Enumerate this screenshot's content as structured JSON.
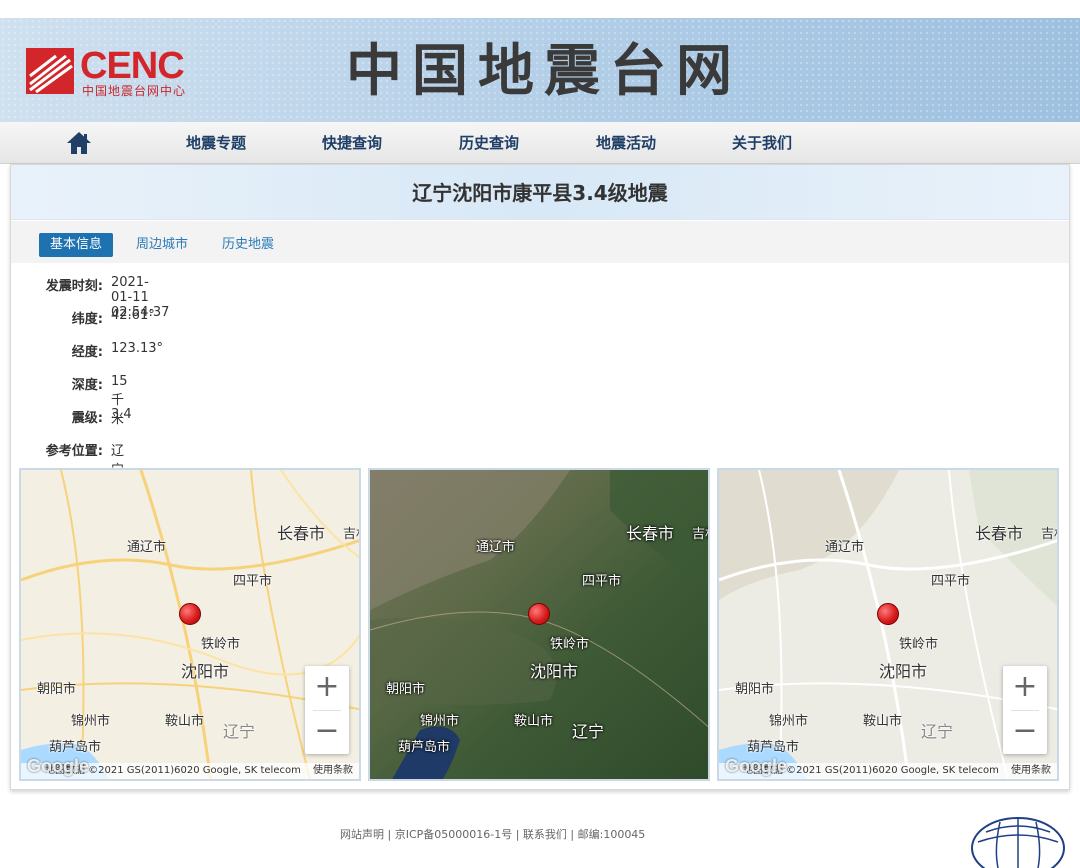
{
  "header": {
    "logo_text": "CENC",
    "logo_sub": "中国地震台网中心",
    "site_title": "中国地震台网"
  },
  "nav": {
    "home_icon": "home-icon",
    "items": [
      "地震专题",
      "快捷查询",
      "历史查询",
      "地震活动",
      "关于我们"
    ]
  },
  "event": {
    "title": "辽宁沈阳市康平县3.4级地震"
  },
  "tabs": [
    {
      "label": "基本信息",
      "active": true
    },
    {
      "label": "周边城市",
      "active": false
    },
    {
      "label": "历史地震",
      "active": false
    }
  ],
  "info": {
    "time_label": "发震时刻:",
    "time_value": "2021-01-11 02:54:37",
    "lat_label": "纬度:",
    "lat_value": "42.61°",
    "lon_label": "经度:",
    "lon_value": "123.13°",
    "depth_label": "深度:",
    "depth_value": "15千米",
    "mag_label": "震级:",
    "mag_value": "3.4",
    "loc_label": "参考位置:",
    "loc_value": "辽宁沈阳市康平县"
  },
  "maps": {
    "cities": {
      "changchun": "长春市",
      "jilin_partial": "吉林",
      "tongliao": "通辽市",
      "siping": "四平市",
      "tieling": "铁岭市",
      "shenyang": "沈阳市",
      "chaoyang": "朝阳市",
      "jinzhou": "锦州市",
      "anshan": "鞍山市",
      "liaoning": "辽宁",
      "huludao": "葫芦岛市"
    },
    "zoom_in": "+",
    "zoom_out": "−",
    "attribution": "地图数据 ©2021 GS(2011)6020 Google, SK telecom",
    "terms": "使用条款",
    "google_logo": "Google",
    "marker_color": "#d81e1e"
  },
  "footer": {
    "text": "网站声明 | 京ICP备05000016-1号 | 联系我们 | 邮编:100045"
  }
}
